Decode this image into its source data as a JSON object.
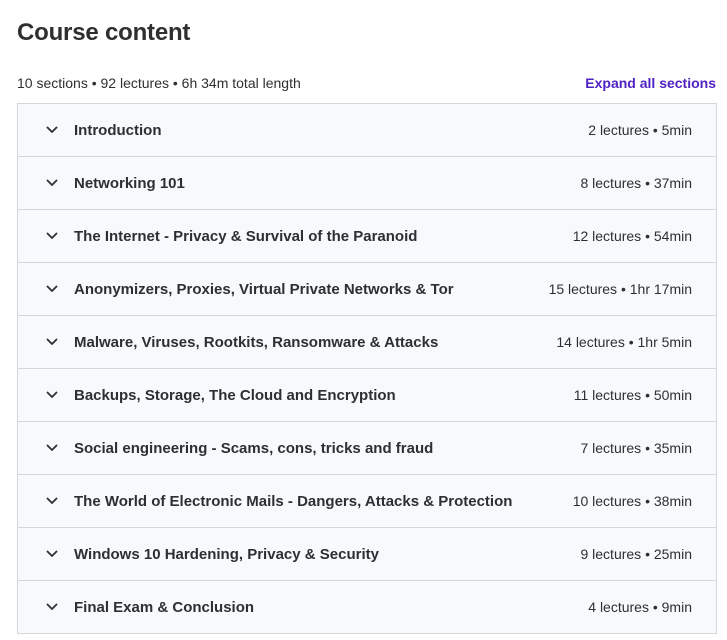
{
  "header": {
    "title": "Course content",
    "stats": "10 sections • 92 lectures • 6h 34m total length",
    "expand_all_label": "Expand all sections"
  },
  "colors": {
    "accent": "#5022c3",
    "row_bg": "#f7f9fa",
    "border": "#d1d7dc",
    "text": "#2d2f31"
  },
  "sections": [
    {
      "title": "Introduction",
      "meta": "2 lectures • 5min",
      "icon": "chevron-down-icon"
    },
    {
      "title": "Networking 101",
      "meta": "8 lectures • 37min",
      "icon": "chevron-down-icon"
    },
    {
      "title": "The Internet - Privacy & Survival of the Paranoid",
      "meta": "12 lectures • 54min",
      "icon": "chevron-down-icon"
    },
    {
      "title": "Anonymizers, Proxies, Virtual Private Networks & Tor",
      "meta": "15 lectures • 1hr 17min",
      "icon": "chevron-down-icon"
    },
    {
      "title": "Malware, Viruses, Rootkits, Ransomware & Attacks",
      "meta": "14 lectures • 1hr 5min",
      "icon": "chevron-down-icon"
    },
    {
      "title": "Backups, Storage, The Cloud and Encryption",
      "meta": "11 lectures • 50min",
      "icon": "chevron-down-icon"
    },
    {
      "title": "Social engineering - Scams, cons, tricks and fraud",
      "meta": "7 lectures • 35min",
      "icon": "chevron-down-icon"
    },
    {
      "title": "The World of Electronic Mails - Dangers, Attacks & Protection",
      "meta": "10 lectures • 38min",
      "icon": "chevron-down-icon"
    },
    {
      "title": "Windows 10 Hardening, Privacy & Security",
      "meta": "9 lectures • 25min",
      "icon": "chevron-down-icon"
    },
    {
      "title": "Final Exam & Conclusion",
      "meta": "4 lectures • 9min",
      "icon": "chevron-down-icon"
    }
  ]
}
